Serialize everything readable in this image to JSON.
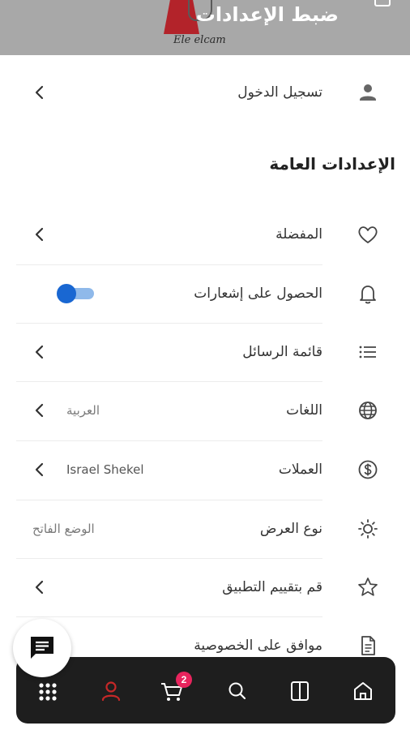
{
  "header": {
    "title": "ضبط الإعدادات",
    "brand_text": "Ele elcam"
  },
  "login": {
    "label": "تسجيل الدخول",
    "icon": "person-icon"
  },
  "general_settings": {
    "title": "الإعدادات العامة",
    "items": [
      {
        "key": "favorites",
        "label": "المفضلة",
        "icon": "heart-icon",
        "control": "chevron"
      },
      {
        "key": "notifications",
        "label": "الحصول على إشعارات",
        "icon": "bell-icon",
        "control": "toggle",
        "toggle_on": true
      },
      {
        "key": "messages",
        "label": "قائمة الرسائل",
        "icon": "list-icon",
        "control": "chevron"
      },
      {
        "key": "languages",
        "label": "اللغات",
        "value": "العربية",
        "icon": "globe-icon",
        "control": "chevron"
      },
      {
        "key": "currencies",
        "label": "العملات",
        "value": "Israel Shekel",
        "icon": "dollar-icon",
        "control": "chevron"
      },
      {
        "key": "display",
        "label": "نوع العرض",
        "value": "الوضع الفاتح",
        "icon": "sun-icon",
        "control": "none"
      },
      {
        "key": "rate",
        "label": "قم بتقييم التطبيق",
        "icon": "star-icon",
        "control": "chevron"
      },
      {
        "key": "privacy",
        "label": "موافق على الخصوصية",
        "icon": "document-icon",
        "control": "none"
      }
    ]
  },
  "bottom_nav": {
    "items": [
      "grid-icon",
      "person-icon",
      "cart-icon",
      "search-icon",
      "book-icon",
      "home-icon"
    ],
    "cart_badge": "2"
  },
  "colors": {
    "accent": "#1967d2",
    "active_nav": "#c62828",
    "badge": "#e8245d",
    "nav_bg": "#1e1e1e"
  }
}
